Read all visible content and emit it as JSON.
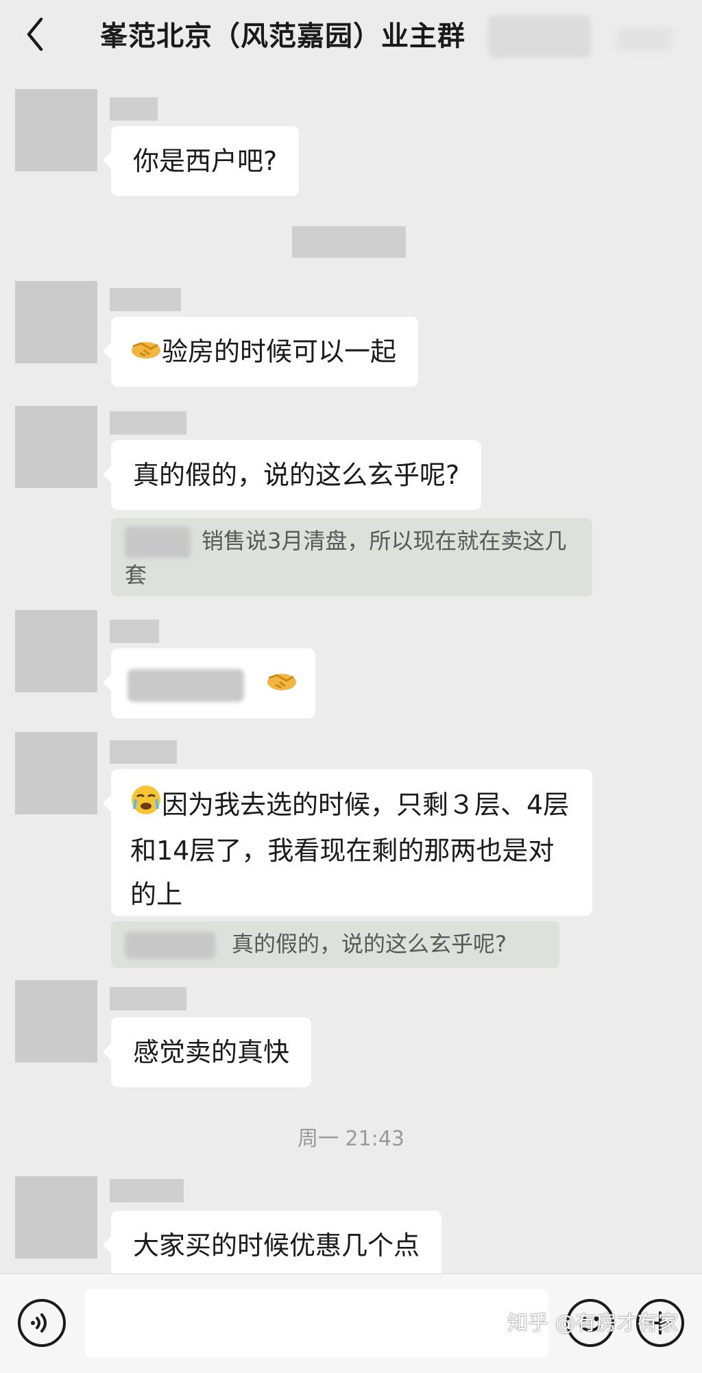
{
  "header": {
    "title": "峯范北京（风范嘉园）业主群",
    "back_icon": "back-chevron-icon"
  },
  "messages": [
    {
      "text": "你是西户吧?"
    },
    {
      "emoji": "handshake-icon",
      "text": "验房的时候可以一起"
    },
    {
      "text": "真的假的，说的这么玄乎呢?"
    },
    {
      "quote": "销售说3月清盘，所以现在就在卖这几套"
    },
    {
      "emoji": "handshake-icon"
    },
    {
      "emoji": "face-with-tears-icon",
      "text": "因为我去选的时候，只剩３层、4层和14层了，我看现在剩的那两也是对的上"
    },
    {
      "quote": "真的假的，说的这么玄乎呢?"
    },
    {
      "text": "感觉卖的真快"
    },
    {
      "text": "大家买的时候优惠几个点"
    }
  ],
  "timestamp": "周一 21:43",
  "input_bar": {
    "voice_icon": "voice-icon",
    "emoji_icon": "smiley-icon",
    "plus_icon": "plus-icon"
  },
  "watermark": "知乎 @有房才有家",
  "colors": {
    "background": "#ececec",
    "bubble": "#ffffff",
    "quote": "#dde0db",
    "placeholder": "#cbcbcb"
  }
}
